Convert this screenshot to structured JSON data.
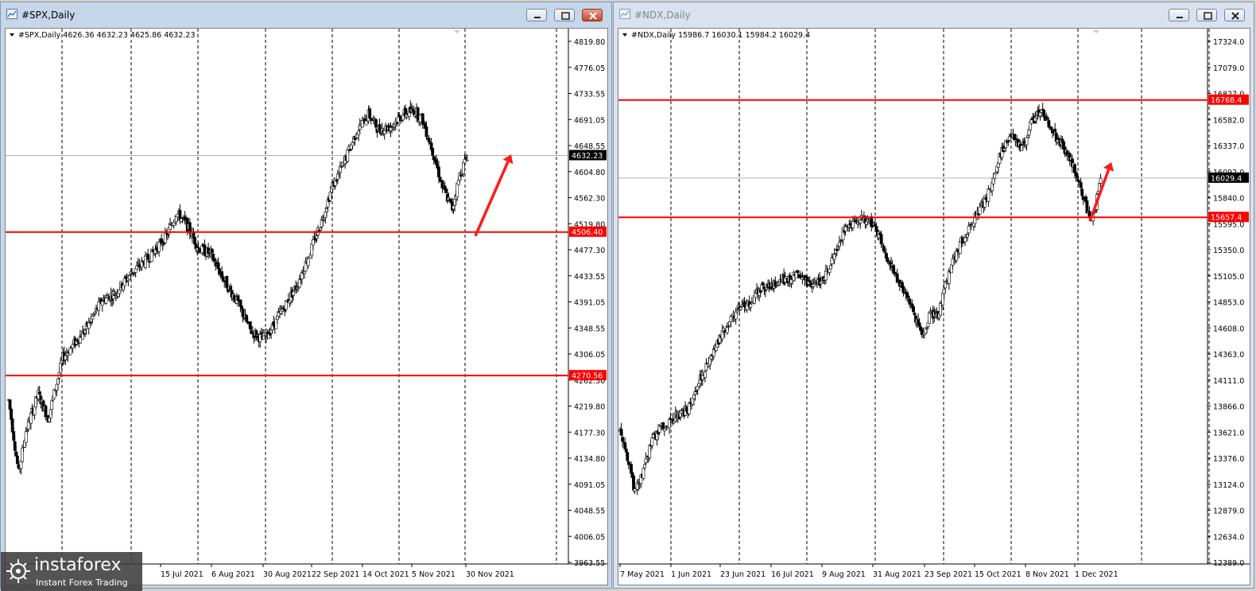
{
  "windows": [
    {
      "title": "#SPX,Daily"
    },
    {
      "title": "#NDX,Daily"
    }
  ],
  "watermark": {
    "brand": "instaforex",
    "tagline": "Instant Forex Trading"
  },
  "chart_data": [
    {
      "type": "candlestick",
      "symbol": "#SPX,Daily",
      "ohlc_label": "#SPX,Daily  4626.36 4632.23 4625.86 4632.23",
      "ylim": [
        3950,
        4840
      ],
      "y_ticks": [
        "4819.80",
        "4776.05",
        "4733.55",
        "4691.05",
        "4648.55",
        "4604.80",
        "4562.30",
        "4519.80",
        "4477.30",
        "4433.55",
        "4391.05",
        "4348.55",
        "4306.05",
        "4262.30",
        "4219.80",
        "4177.30",
        "4134.80",
        "4091.05",
        "4048.55",
        "4006.05",
        "3963.55"
      ],
      "x_labels": [
        "15 Jul 2021",
        "6 Aug 2021",
        "30 Aug 2021",
        "22 Sep 2021",
        "14 Oct 2021",
        "5 Nov 2021",
        "30 Nov 2021"
      ],
      "current_price": {
        "value": 4632.23,
        "label": "4632.23"
      },
      "hlines": [
        {
          "value": 4506.4,
          "label": "4506.40",
          "color": "#ff0000"
        },
        {
          "value": 4270.56,
          "label": "4270.56",
          "color": "#ff0000"
        }
      ],
      "arrow": {
        "from": [
          4500,
          0
        ],
        "to": [
          4634,
          0
        ],
        "color": "#ff1a1a"
      },
      "anchors": [
        [
          0,
          4230
        ],
        [
          8,
          4110
        ],
        [
          14,
          4180
        ],
        [
          24,
          4240
        ],
        [
          32,
          4200
        ],
        [
          44,
          4300
        ],
        [
          62,
          4345
        ],
        [
          76,
          4395
        ],
        [
          86,
          4405
        ],
        [
          100,
          4440
        ],
        [
          114,
          4465
        ],
        [
          128,
          4500
        ],
        [
          136,
          4538
        ],
        [
          144,
          4520
        ],
        [
          154,
          4480
        ],
        [
          164,
          4470
        ],
        [
          174,
          4430
        ],
        [
          186,
          4390
        ],
        [
          196,
          4345
        ],
        [
          206,
          4330
        ],
        [
          214,
          4350
        ],
        [
          224,
          4385
        ],
        [
          234,
          4420
        ],
        [
          244,
          4470
        ],
        [
          254,
          4525
        ],
        [
          262,
          4578
        ],
        [
          272,
          4620
        ],
        [
          282,
          4670
        ],
        [
          292,
          4700
        ],
        [
          300,
          4675
        ],
        [
          310,
          4680
        ],
        [
          320,
          4700
        ],
        [
          330,
          4706
        ],
        [
          336,
          4690
        ],
        [
          344,
          4640
        ],
        [
          352,
          4580
        ],
        [
          360,
          4545
        ],
        [
          366,
          4600
        ],
        [
          372,
          4632
        ]
      ]
    },
    {
      "type": "candlestick",
      "symbol": "#NDX,Daily",
      "ohlc_label": "#NDX,Daily  15986.7 16030.1 15984.2 16029.4",
      "ylim": [
        12350,
        17400
      ],
      "y_ticks": [
        "17324.0",
        "17079.0",
        "16827.0",
        "16582.0",
        "16337.0",
        "16092.0",
        "15840.0",
        "15595.0",
        "15350.0",
        "15105.0",
        "14853.0",
        "14608.0",
        "14363.0",
        "14111.0",
        "13866.0",
        "13621.0",
        "13376.0",
        "13124.0",
        "12879.0",
        "12634.0",
        "12389.0"
      ],
      "x_labels": [
        "7 May 2021",
        "1 Jun 2021",
        "23 Jun 2021",
        "16 Jul 2021",
        "9 Aug 2021",
        "31 Aug 2021",
        "23 Sep 2021",
        "15 Oct 2021",
        "8 Nov 2021",
        "1 Dec 2021"
      ],
      "current_price": {
        "value": 16029.4,
        "label": "16029.4"
      },
      "hlines": [
        {
          "value": 16768.4,
          "label": "16768.4",
          "color": "#ff0000"
        },
        {
          "value": 15657.4,
          "label": "15657.4",
          "color": "#ff0000"
        }
      ],
      "arrow": {
        "from": [
          15620,
          0
        ],
        "to": [
          16180,
          0
        ],
        "color": "#ff1a1a"
      },
      "anchors": [
        [
          0,
          13650
        ],
        [
          6,
          13400
        ],
        [
          12,
          13050
        ],
        [
          18,
          13200
        ],
        [
          26,
          13550
        ],
        [
          36,
          13700
        ],
        [
          46,
          13780
        ],
        [
          56,
          13850
        ],
        [
          66,
          14150
        ],
        [
          78,
          14450
        ],
        [
          88,
          14650
        ],
        [
          96,
          14780
        ],
        [
          106,
          14850
        ],
        [
          114,
          14980
        ],
        [
          124,
          15020
        ],
        [
          134,
          15080
        ],
        [
          144,
          15100
        ],
        [
          152,
          15050
        ],
        [
          158,
          15000
        ],
        [
          166,
          15100
        ],
        [
          174,
          15300
        ],
        [
          182,
          15550
        ],
        [
          190,
          15620
        ],
        [
          198,
          15640
        ],
        [
          206,
          15600
        ],
        [
          212,
          15450
        ],
        [
          218,
          15250
        ],
        [
          224,
          15100
        ],
        [
          232,
          14900
        ],
        [
          240,
          14700
        ],
        [
          246,
          14550
        ],
        [
          252,
          14750
        ],
        [
          258,
          14700
        ],
        [
          264,
          15000
        ],
        [
          272,
          15300
        ],
        [
          280,
          15500
        ],
        [
          290,
          15700
        ],
        [
          300,
          15900
        ],
        [
          310,
          16300
        ],
        [
          318,
          16450
        ],
        [
          326,
          16300
        ],
        [
          334,
          16550
        ],
        [
          342,
          16650
        ],
        [
          350,
          16500
        ],
        [
          358,
          16350
        ],
        [
          366,
          16200
        ],
        [
          374,
          15950
        ],
        [
          380,
          15700
        ],
        [
          384,
          15650
        ],
        [
          390,
          16029
        ]
      ]
    }
  ]
}
